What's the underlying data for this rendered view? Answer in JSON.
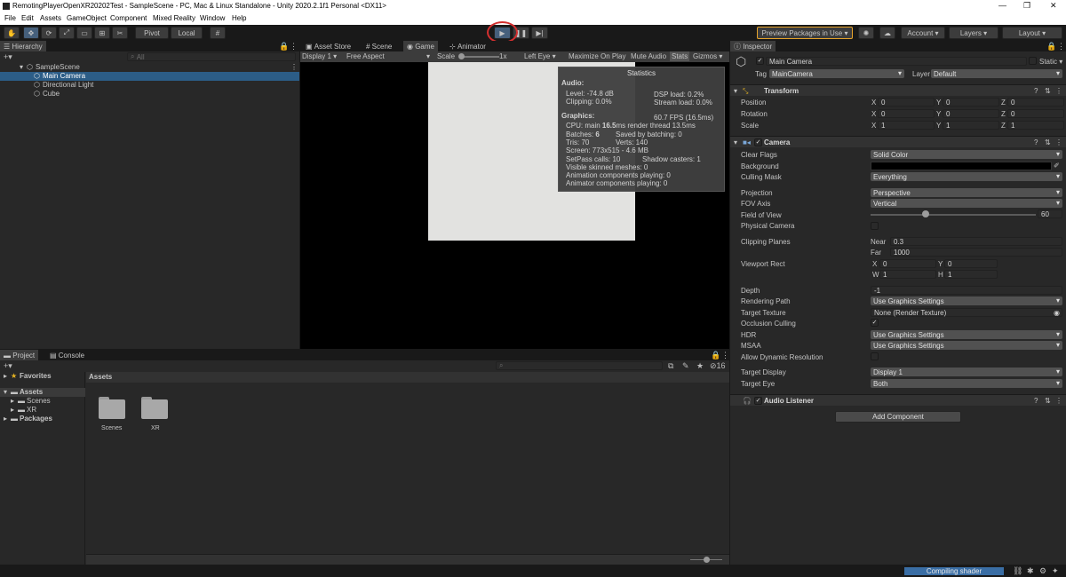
{
  "window": {
    "title": "RemotingPlayerOpenXR20202Test - SampleScene - PC, Mac & Linux Standalone - Unity 2020.2.1f1 Personal <DX11>"
  },
  "menu": [
    "File",
    "Edit",
    "Assets",
    "GameObject",
    "Component",
    "Mixed Reality",
    "Window",
    "Help"
  ],
  "toolbar": {
    "pivot": "Pivot",
    "local": "Local",
    "preview_packages": "Preview Packages in Use",
    "account": "Account",
    "layers": "Layers",
    "layout": "Layout",
    "play_highlight_color": "#d32f2f"
  },
  "hierarchy": {
    "tab": "Hierarchy",
    "search_placeholder": "All",
    "scene": "SampleScene",
    "items": [
      "Main Camera",
      "Directional Light",
      "Cube"
    ]
  },
  "center_tabs": [
    "Asset Store",
    "Scene",
    "Game",
    "Animator"
  ],
  "game": {
    "display": "Display 1",
    "aspect": "Free Aspect",
    "scale_label": "Scale",
    "scale_value": "1x",
    "eye": "Left Eye",
    "maximize": "Maximize On Play",
    "mute": "Mute Audio",
    "stats": "Stats",
    "gizmos": "Gizmos"
  },
  "stats": {
    "title": "Statistics",
    "audio_header": "Audio:",
    "level": "Level: -74.8 dB",
    "clipping": "Clipping: 0.0%",
    "dsp": "DSP load: 0.2%",
    "stream": "Stream load: 0.0%",
    "graphics_header": "Graphics:",
    "fps": "60.7 FPS (16.5ms)",
    "cpu_prefix": "CPU: main ",
    "cpu_main": "16.5",
    "cpu_suffix": "ms  render thread 13.5ms",
    "batches_prefix": "Batches: ",
    "batches": "6",
    "saved_batching": "Saved by batching: 0",
    "tris": "Tris: 70",
    "verts": "Verts: 140",
    "screen": "Screen: 773x515 - 4.6 MB",
    "setpass": "SetPass calls: 10",
    "shadow": "Shadow casters: 1",
    "skinned": "Visible skinned meshes: 0",
    "anim_playing": "Animation components playing: 0",
    "animator_playing": "Animator components playing: 0"
  },
  "project": {
    "tabs": [
      "Project",
      "Console"
    ],
    "favorites": "Favorites",
    "assets": "Assets",
    "tree": [
      "Scenes",
      "XR"
    ],
    "packages": "Packages",
    "breadcrumb": "Assets",
    "folders": [
      "Scenes",
      "XR"
    ],
    "count": "16"
  },
  "inspector": {
    "tab": "Inspector",
    "object_name": "Main Camera",
    "static": "Static",
    "tag_label": "Tag",
    "tag": "MainCamera",
    "layer_label": "Layer",
    "layer": "Default",
    "transform": {
      "name": "Transform",
      "rows": [
        {
          "label": "Position",
          "x": "0",
          "y": "0",
          "z": "0"
        },
        {
          "label": "Rotation",
          "x": "0",
          "y": "0",
          "z": "0"
        },
        {
          "label": "Scale",
          "x": "1",
          "y": "1",
          "z": "1"
        }
      ]
    },
    "camera": {
      "name": "Camera",
      "clear_flags_label": "Clear Flags",
      "clear_flags": "Solid Color",
      "background_label": "Background",
      "background_color": "#000000",
      "culling_label": "Culling Mask",
      "culling": "Everything",
      "projection_label": "Projection",
      "projection": "Perspective",
      "fov_axis_label": "FOV Axis",
      "fov_axis": "Vertical",
      "fov_label": "Field of View",
      "fov": "60",
      "fov_fraction": 0.335,
      "physical_label": "Physical Camera",
      "clipping_label": "Clipping Planes",
      "near_label": "Near",
      "near": "0.3",
      "far_label": "Far",
      "far": "1000",
      "viewport_label": "Viewport Rect",
      "vx": "0",
      "vy": "0",
      "vw": "1",
      "vh": "1",
      "depth_label": "Depth",
      "depth": "-1",
      "rendering_label": "Rendering Path",
      "rendering": "Use Graphics Settings",
      "target_tex_label": "Target Texture",
      "target_tex": "None (Render Texture)",
      "occlusion_label": "Occlusion Culling",
      "hdr_label": "HDR",
      "hdr": "Use Graphics Settings",
      "msaa_label": "MSAA",
      "msaa": "Use Graphics Settings",
      "dynres_label": "Allow Dynamic Resolution",
      "target_display_label": "Target Display",
      "target_display": "Display 1",
      "target_eye_label": "Target Eye",
      "target_eye": "Both"
    },
    "audio_listener": "Audio Listener",
    "add_component": "Add Component"
  },
  "status": {
    "text": "Compiling shader",
    "accent": "#3a6ea5"
  }
}
